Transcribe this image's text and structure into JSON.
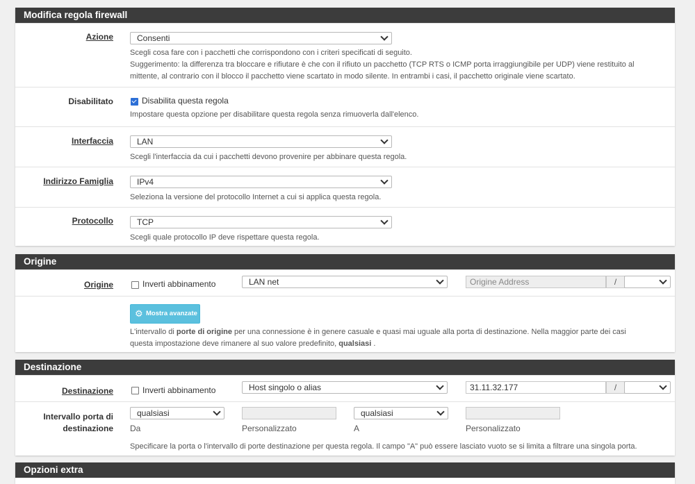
{
  "rule": {
    "heading": "Modifica regola firewall",
    "action": {
      "label": "Azione",
      "value": "Consenti",
      "help1": "Scegli cosa fare con i pacchetti che corrispondono con i criteri specificati di seguito.",
      "help2": "Suggerimento: la differenza tra bloccare e rifiutare è che con il rifiuto un pacchetto (TCP RTS o ICMP porta irraggiungibile per UDP) viene restituito al",
      "help3": "mittente, al contrario con il blocco il pacchetto viene scartato in modo silente. In entrambi i casi, il pacchetto originale viene scartato."
    },
    "disabled": {
      "label": "Disabilitato",
      "checkbox_label": "Disabilita questa regola",
      "checked": true,
      "help": "Impostare questa opzione per disabilitare questa regola senza rimuoverla dall'elenco."
    },
    "interface": {
      "label": "Interfaccia",
      "value": "LAN",
      "help": "Scegli l'interfaccia da cui i pacchetti devono provenire per abbinare questa regola."
    },
    "family": {
      "label": "Indirizzo Famiglia",
      "value": "IPv4",
      "help": "Seleziona la versione del protocollo Internet a cui si applica questa regola."
    },
    "protocol": {
      "label": "Protocollo",
      "value": "TCP",
      "help": "Scegli quale protocollo IP deve rispettare questa regola."
    }
  },
  "source": {
    "heading": "Origine",
    "label": "Origine",
    "invert_label": "Inverti abbinamento",
    "type_value": "LAN net",
    "address_placeholder": "Origine Address",
    "slash": "/",
    "advanced_button": "Mostra avanzate",
    "help_a": "L'intervallo di ",
    "help_b": "porte di origine",
    "help_c": " per una connessione è in genere casuale e quasi mai uguale alla porta di destinazione. Nella maggior parte dei casi",
    "help_d": "questa impostazione deve rimanere al suo valore predefinito, ",
    "help_e": "qualsiasi",
    "help_f": " ."
  },
  "destination": {
    "heading": "Destinazione",
    "label": "Destinazione",
    "invert_label": "Inverti abbinamento",
    "type_value": "Host singolo o alias",
    "address_value": "31.11.32.177",
    "slash": "/",
    "port_range_label_1": "Intervallo porta di",
    "port_range_label_2": "destinazione",
    "from_value": "qualsiasi",
    "from_label": "Da",
    "custom_label_1": "Personalizzato",
    "to_value": "qualsiasi",
    "to_label": "A",
    "custom_label_2": "Personalizzato",
    "help": "Specificare la porta o l'intervallo di porte destinazione per questa regola. Il campo \"A\" può essere lasciato vuoto se si limita a filtrare una singola porta."
  },
  "extra": {
    "heading": "Opzioni extra"
  },
  "colors": {
    "heading_bg": "#3c3c3c",
    "checkbox_checked": "#2c6fd6",
    "advanced_button": "#5bc0de"
  }
}
